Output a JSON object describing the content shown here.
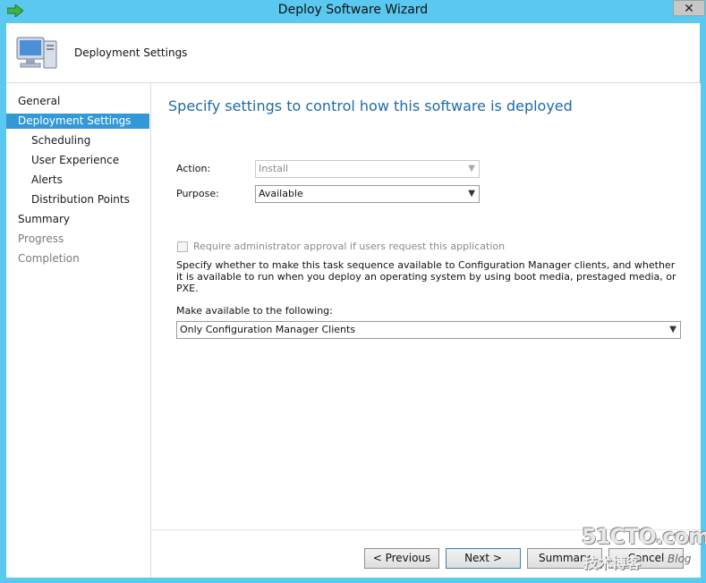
{
  "window": {
    "title": "Deploy Software Wizard",
    "close_glyph": "✕"
  },
  "header": {
    "title": "Deployment Settings",
    "icon": "computer-icon"
  },
  "nav": {
    "items": [
      {
        "label": "General",
        "state": "normal"
      },
      {
        "label": "Deployment Settings",
        "state": "active"
      },
      {
        "label": "Scheduling",
        "state": "sub"
      },
      {
        "label": "User Experience",
        "state": "sub"
      },
      {
        "label": "Alerts",
        "state": "sub"
      },
      {
        "label": "Distribution Points",
        "state": "sub"
      },
      {
        "label": "Summary",
        "state": "normal"
      },
      {
        "label": "Progress",
        "state": "disabled"
      },
      {
        "label": "Completion",
        "state": "disabled"
      }
    ]
  },
  "content": {
    "heading": "Specify settings to control how this software is deployed",
    "action_label": "Action:",
    "action_value": "Install",
    "purpose_label": "Purpose:",
    "purpose_value": "Available",
    "approval_label": "Require administrator approval if users request this application",
    "approval_checked": false,
    "description": "Specify whether to make this task sequence available to Configuration Manager clients, and whether it is available to run when you deploy an operating system by using boot media, prestaged media, or PXE.",
    "make_available_label": "Make available to the following:",
    "make_available_value": "Only Configuration Manager Clients"
  },
  "buttons": {
    "previous": "< Previous",
    "next": "Next >",
    "summary": "Summary",
    "cancel": "Cancel"
  },
  "watermark": {
    "site": "51CTO.com",
    "cn": "技术博客",
    "blog": "Blog"
  },
  "colors": {
    "accent": "#3399d6",
    "heading": "#1e6aa8",
    "titlebar": "#5bc8f0"
  }
}
